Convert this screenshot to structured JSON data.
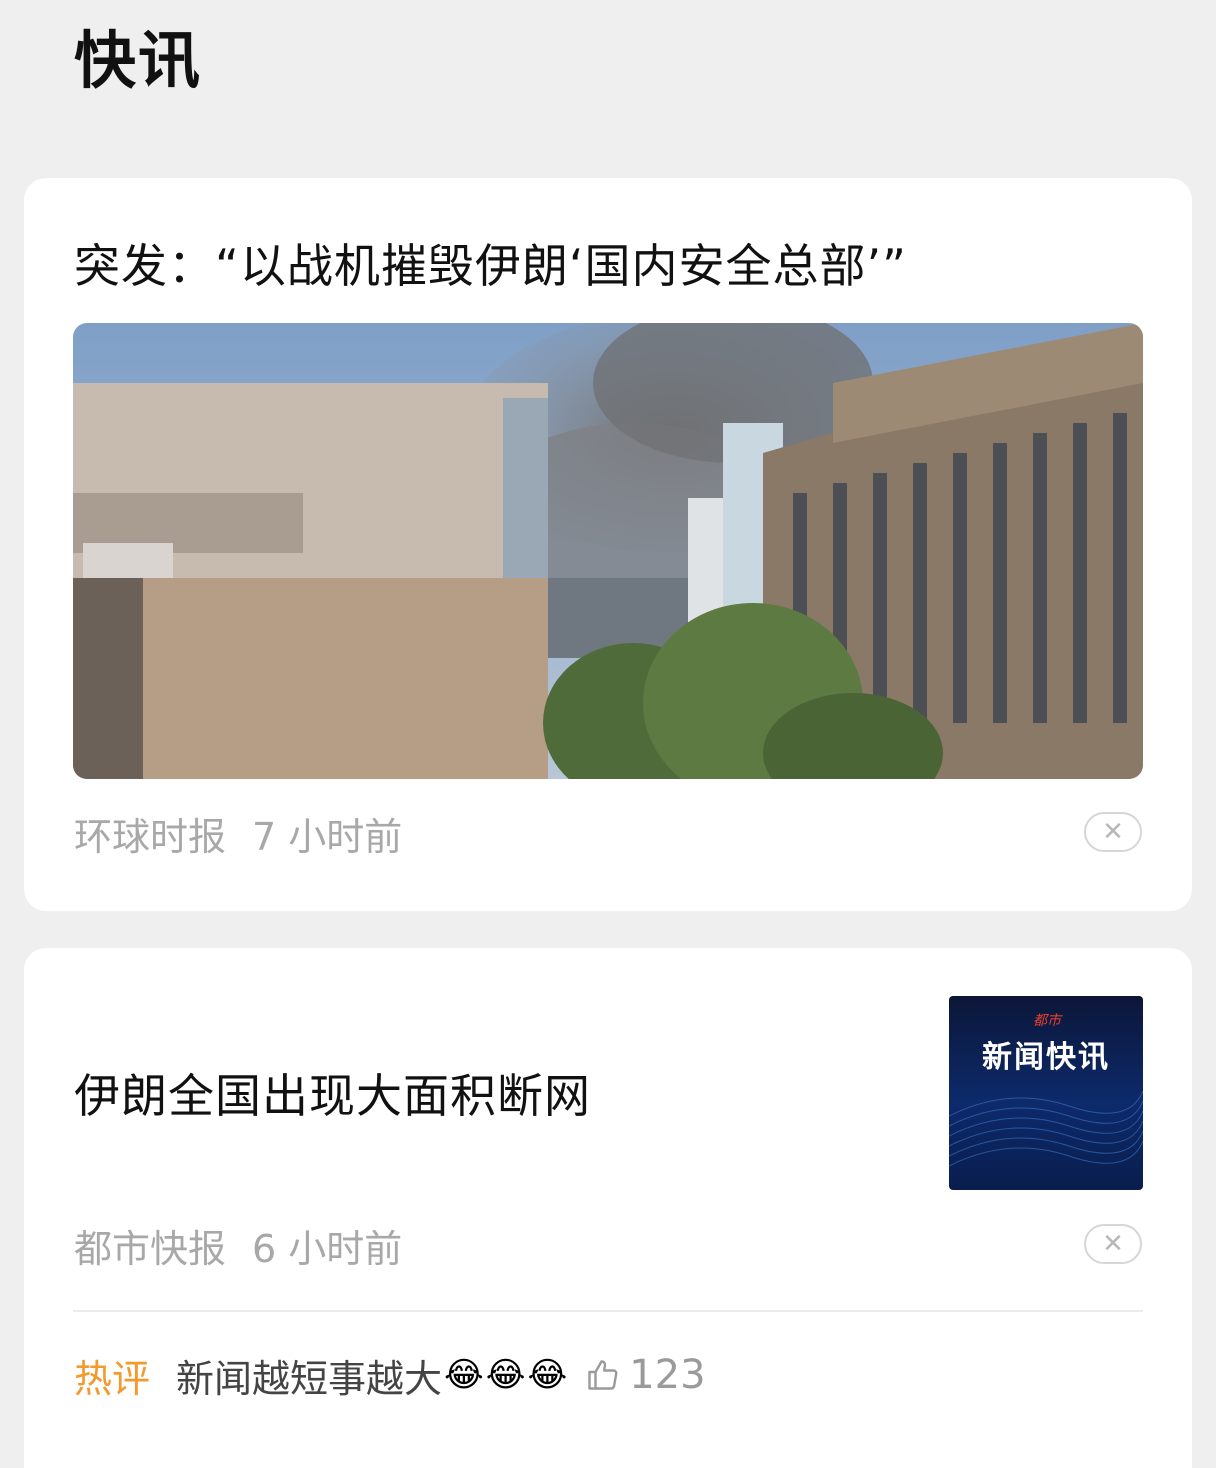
{
  "section": {
    "title": "快讯"
  },
  "cards": [
    {
      "headline": "突发：“以战机摧毁伊朗‘国内安全总部’”",
      "source": "环球时报",
      "time": "7 小时前",
      "close_label": "✕"
    },
    {
      "headline": "伊朗全国出现大面积断网",
      "thumbnail_text": "新闻快讯",
      "thumbnail_logo": "都市",
      "source": "都市快报",
      "time": "6 小时前",
      "close_label": "✕",
      "hot_comment": {
        "label": "热评",
        "text": "新闻越短事越大",
        "emojis": [
          "😂",
          "😂",
          "😂"
        ],
        "likes": "123"
      }
    }
  ],
  "colors": {
    "accent_hot": "#f29a2e",
    "meta_gray": "#a8a8a8",
    "background": "#efefef"
  }
}
